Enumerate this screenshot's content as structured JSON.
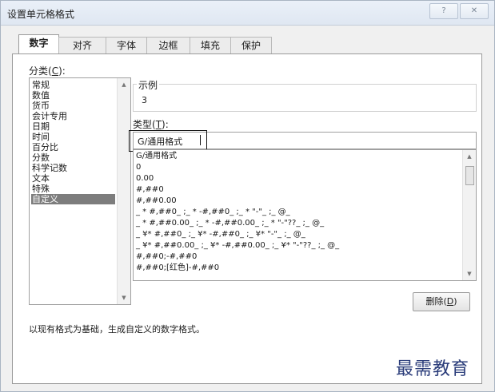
{
  "window": {
    "title": "设置单元格格式",
    "help_label": "?",
    "close_label": "✕"
  },
  "tabs": [
    {
      "label": "数字",
      "active": true
    },
    {
      "label": "对齐",
      "active": false
    },
    {
      "label": "字体",
      "active": false
    },
    {
      "label": "边框",
      "active": false
    },
    {
      "label": "填充",
      "active": false
    },
    {
      "label": "保护",
      "active": false
    }
  ],
  "category": {
    "label": "分类(",
    "hotkey": "C",
    "label_end": "):",
    "items": [
      "常规",
      "数值",
      "货币",
      "会计专用",
      "日期",
      "时间",
      "百分比",
      "分数",
      "科学记数",
      "文本",
      "特殊",
      "自定义"
    ],
    "selected_index": 11
  },
  "sample": {
    "label": "示例",
    "value": "3"
  },
  "type": {
    "label": "类型(",
    "hotkey": "T",
    "label_end": "):",
    "value": "G/通用格式",
    "formats": [
      "G/通用格式",
      "0",
      "0.00",
      "#,##0",
      "#,##0.00",
      "_ * #,##0_ ;_ * -#,##0_ ;_ * \"-\"_ ;_ @_",
      "_ * #,##0.00_ ;_ * -#,##0.00_ ;_ * \"-\"??_ ;_ @_",
      "_ ¥* #,##0_ ;_ ¥* -#,##0_ ;_ ¥* \"-\"_ ;_ @_",
      "_ ¥* #,##0.00_ ;_ ¥* -#,##0.00_ ;_ ¥* \"-\"??_ ;_ @_",
      "#,##0;-#,##0",
      "#,##0;[红色]-#,##0"
    ]
  },
  "delete_button": {
    "label": "删除(",
    "hotkey": "D",
    "label_end": ")"
  },
  "description": "以现有格式为基础，生成自定义的数字格式。",
  "watermark": "最需教育"
}
